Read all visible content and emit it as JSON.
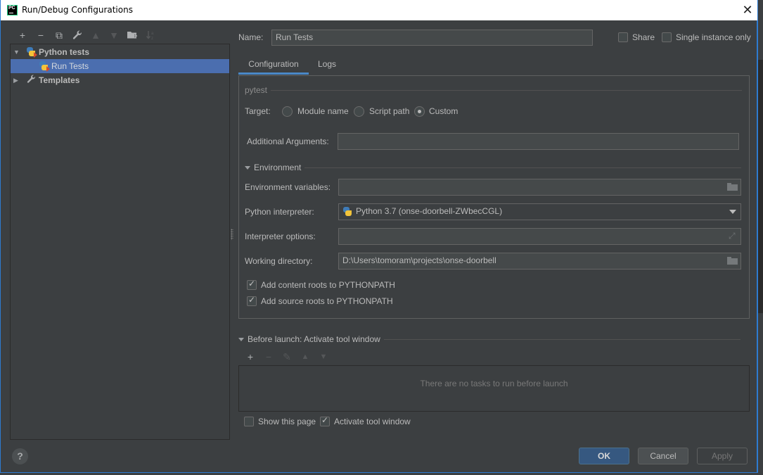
{
  "window": {
    "title": "Run/Debug Configurations",
    "app_icon_label": "PC",
    "close_glyph": "✕"
  },
  "left_toolbar": [
    {
      "name": "add-icon",
      "glyph": "+",
      "enabled": true
    },
    {
      "name": "remove-icon",
      "glyph": "−",
      "enabled": true
    },
    {
      "name": "copy-icon",
      "glyph": "⧉",
      "enabled": true
    },
    {
      "name": "wrench-icon",
      "glyph": "🔧",
      "enabled": true
    },
    {
      "name": "move-up-icon",
      "glyph": "▲",
      "enabled": false
    },
    {
      "name": "move-down-icon",
      "glyph": "▼",
      "enabled": false
    },
    {
      "name": "new-folder-icon",
      "glyph": "📁",
      "enabled": true
    },
    {
      "name": "sort-icon",
      "glyph": "⇣",
      "enabled": false
    }
  ],
  "tree": {
    "items": [
      {
        "label": "Python tests",
        "expanded": true,
        "bold": true
      },
      {
        "label": "Run Tests",
        "selected": true
      },
      {
        "label": "Templates",
        "expanded": false,
        "bold": true
      }
    ]
  },
  "header": {
    "name_label": "Name:",
    "name_value": "Run Tests",
    "share_label": "Share",
    "share_checked": false,
    "single_instance_label": "Single instance only",
    "single_instance_checked": false
  },
  "tabs": [
    {
      "label": "Configuration",
      "active": true
    },
    {
      "label": "Logs",
      "active": false
    }
  ],
  "config": {
    "section_title": "pytest",
    "target_label": "Target:",
    "target_options": [
      {
        "label": "Module name",
        "selected": false
      },
      {
        "label": "Script path",
        "selected": false
      },
      {
        "label": "Custom",
        "selected": true
      }
    ],
    "additional_args_label": "Additional Arguments:",
    "additional_args_value": "",
    "environment_title": "Environment",
    "env_vars_label": "Environment variables:",
    "env_vars_value": "",
    "interpreter_label": "Python interpreter:",
    "interpreter_value": "Python 3.7 (onse-doorbell-ZWbecCGL)",
    "interpreter_options_label": "Interpreter options:",
    "interpreter_options_value": "",
    "working_dir_label": "Working directory:",
    "working_dir_value": "D:\\Users\\tomoram\\projects\\onse-doorbell",
    "content_roots_label": "Add content roots to PYTHONPATH",
    "content_roots_checked": true,
    "source_roots_label": "Add source roots to PYTHONPATH",
    "source_roots_checked": true
  },
  "before_launch": {
    "title": "Before launch: Activate tool window",
    "toolbar": [
      {
        "name": "add-task-icon",
        "glyph": "+",
        "enabled": true
      },
      {
        "name": "remove-task-icon",
        "glyph": "−",
        "enabled": false
      },
      {
        "name": "edit-task-icon",
        "glyph": "✎",
        "enabled": false
      },
      {
        "name": "move-task-up-icon",
        "glyph": "▲",
        "enabled": false
      },
      {
        "name": "move-task-down-icon",
        "glyph": "▼",
        "enabled": false
      }
    ],
    "empty_text": "There are no tasks to run before launch",
    "show_page_label": "Show this page",
    "show_page_checked": false,
    "activate_tool_label": "Activate tool window",
    "activate_tool_checked": true
  },
  "buttons": {
    "help": "?",
    "ok": "OK",
    "cancel": "Cancel",
    "apply": "Apply"
  }
}
